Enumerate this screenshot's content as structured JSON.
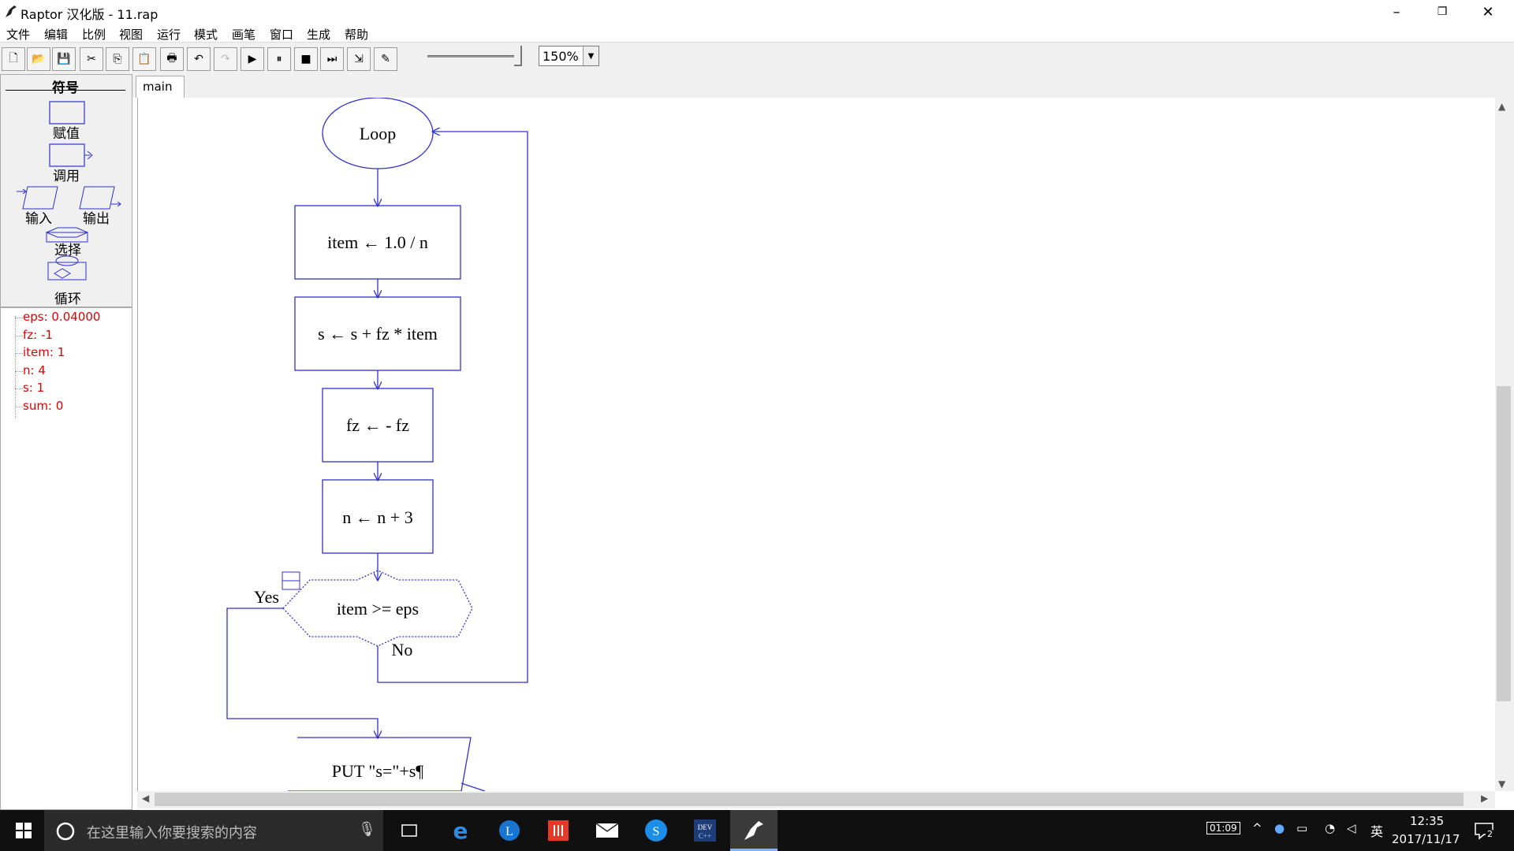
{
  "window": {
    "title": "Raptor 汉化版 - 11.rap",
    "minimize": "–",
    "restore": "❐",
    "close": "✕"
  },
  "menu": [
    "文件",
    "编辑",
    "比例",
    "视图",
    "运行",
    "模式",
    "画笔",
    "窗口",
    "生成",
    "帮助"
  ],
  "toolbar": {
    "buttons": [
      {
        "name": "new-icon",
        "glyph": "🗋"
      },
      {
        "name": "open-icon",
        "glyph": "📂"
      },
      {
        "name": "save-icon",
        "glyph": "💾"
      },
      {
        "name": "cut-icon",
        "glyph": "✂"
      },
      {
        "name": "copy-icon",
        "glyph": "⎘"
      },
      {
        "name": "paste-icon",
        "glyph": "📋"
      },
      {
        "name": "print-icon",
        "glyph": "🖶"
      },
      {
        "name": "undo-icon",
        "glyph": "↶"
      },
      {
        "name": "redo-icon",
        "glyph": "↷"
      },
      {
        "name": "play-icon",
        "glyph": "▶"
      },
      {
        "name": "pause-icon",
        "glyph": "⏸"
      },
      {
        "name": "stop-icon",
        "glyph": "■"
      },
      {
        "name": "step-icon",
        "glyph": "⏭"
      },
      {
        "name": "step-into-icon",
        "glyph": "⇲"
      },
      {
        "name": "pen-icon",
        "glyph": "✎"
      }
    ],
    "zoom": "150%",
    "speed_level": 0.95
  },
  "symbols": {
    "header": "符号",
    "assign": "赋值",
    "call": "调用",
    "input": "输入",
    "output": "输出",
    "select": "选择",
    "loop": "循环"
  },
  "variables": [
    "eps: 0.04000",
    "fz: -1",
    "item: 1",
    "n: 4",
    "s: 1",
    "sum: 0"
  ],
  "tabs": [
    "main"
  ],
  "flow": {
    "loop": "Loop",
    "step1": "item ← 1.0 / n",
    "step2": "s ← s + fz * item",
    "step3": "fz ←  - fz",
    "step4": "n ← n + 3",
    "condition": "item >= eps",
    "yes": "Yes",
    "no": "No",
    "output": "PUT \"s=\"+s¶"
  },
  "taskbar": {
    "search_placeholder": "在这里输入你要搜索的内容",
    "time": "12:35",
    "date": "2017/11/17",
    "battery_time": "01:09",
    "ime": "英",
    "notif_count": "2"
  },
  "colors": {
    "flow_line": "#3030d0",
    "var_text": "#e00000"
  }
}
